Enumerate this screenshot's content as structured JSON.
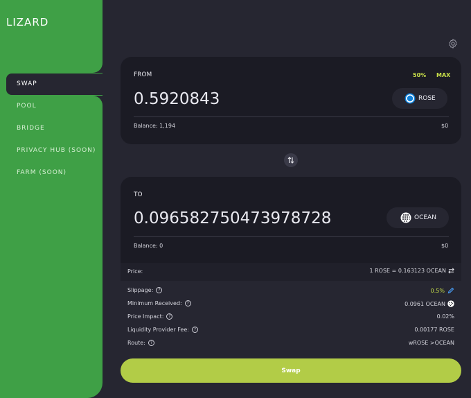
{
  "app": {
    "logo": "LIZARD"
  },
  "sidebar": {
    "items": [
      {
        "label": "SWAP",
        "active": true
      },
      {
        "label": "POOL"
      },
      {
        "label": "BRIDGE"
      },
      {
        "label": "PRIVACY HUB (SOON)"
      },
      {
        "label": "FARM (SOON)"
      }
    ]
  },
  "from": {
    "label": "FROM",
    "half_label": "50%",
    "max_label": "MAX",
    "amount": "0.5920843",
    "token": "ROSE",
    "balance": "Balance: 1,194",
    "usd": "$0"
  },
  "to": {
    "label": "TO",
    "amount": "0.09658275047397872​8",
    "token": "OCEAN",
    "balance": "Balance: 0",
    "usd": "$0"
  },
  "details": {
    "price_label": "Price:",
    "price_value": "1 ROSE = 0.163123 OCEAN",
    "slippage_label": "Slippage:",
    "slippage_value": "0.5%",
    "min_received_label": "Minimum Received:",
    "min_received_value": "0.0961 OCEAN",
    "price_impact_label": "Price Impact:",
    "price_impact_value": "0.02%",
    "lp_fee_label": "Liquidity Provider Fee:",
    "lp_fee_value": "0.00177 ROSE",
    "route_label": "Route:",
    "route_value": "wROSE >OCEAN"
  },
  "actions": {
    "swap_label": "Swap"
  },
  "icons": {
    "settings": "gear-icon",
    "swap_direction": "swap-arrows-icon",
    "rose": "rose-token-icon",
    "ocean": "ocean-token-icon",
    "help": "question-icon",
    "edit": "pencil-icon",
    "invert": "invert-price-icon"
  },
  "colors": {
    "brand_green": "#3fa046",
    "accent_lime": "#b2cc47",
    "card": "#1b1b24"
  }
}
